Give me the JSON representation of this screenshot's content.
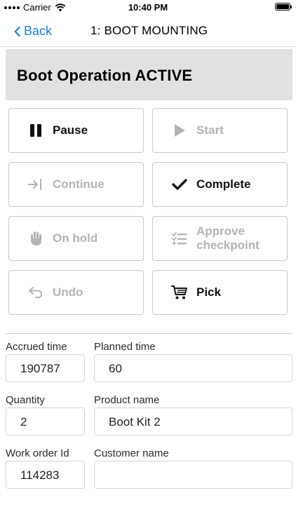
{
  "status_bar": {
    "carrier": "Carrier",
    "time": "10:40 PM"
  },
  "nav": {
    "back_label": "Back",
    "title": "1: BOOT MOUNTING"
  },
  "operation": {
    "title": "Boot Operation ACTIVE"
  },
  "buttons": {
    "pause": "Pause",
    "start": "Start",
    "continue": "Continue",
    "complete": "Complete",
    "on_hold": "On hold",
    "approve_line1": "Approve",
    "approve_line2": "checkpoint",
    "undo": "Undo",
    "pick": "Pick"
  },
  "fields": {
    "accrued_time": {
      "label": "Accrued time",
      "value": "190787"
    },
    "planned_time": {
      "label": "Planned time",
      "value": "60"
    },
    "quantity": {
      "label": "Quantity",
      "value": "2"
    },
    "product_name": {
      "label": "Product name",
      "value": "Boot Kit 2"
    },
    "work_order_id": {
      "label": "Work order Id",
      "value": "114283"
    },
    "customer_name": {
      "label": "Customer name",
      "value": ""
    }
  },
  "icons": {
    "pause": "pause-icon",
    "start": "play-icon",
    "continue": "step-forward-icon",
    "complete": "checkmark-icon",
    "on_hold": "hand-icon",
    "approve": "checklist-icon",
    "undo": "undo-icon",
    "pick": "cart-icon"
  },
  "colors": {
    "accent": "#1a7ee6",
    "header_bg": "#e1e1e1",
    "disabled": "#b3b3b3"
  }
}
